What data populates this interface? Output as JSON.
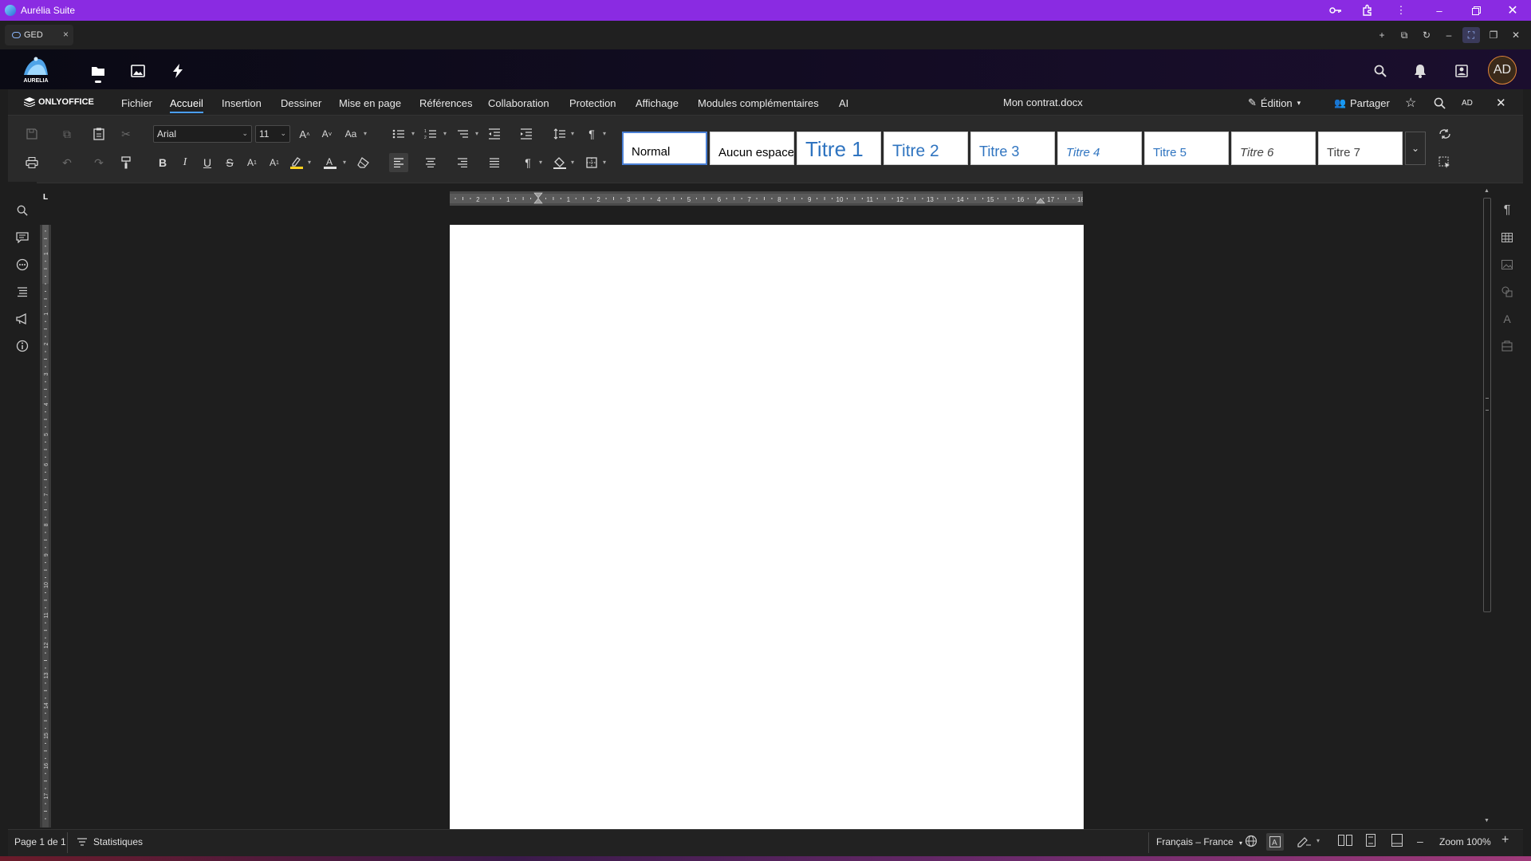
{
  "window": {
    "title": "Aurélia Suite"
  },
  "browser": {
    "tab_label": "GED"
  },
  "app_nav": {
    "logo_text": "AURELIA",
    "avatar_initials": "AD"
  },
  "onlyoffice": {
    "brand": "ONLYOFFICE",
    "menu": [
      "Fichier",
      "Accueil",
      "Insertion",
      "Dessiner",
      "Mise en page",
      "Références",
      "Collaboration",
      "Protection",
      "Affichage",
      "Modules complémentaires",
      "AI"
    ],
    "active_menu": "Accueil",
    "document_title": "Mon contrat.docx",
    "mode_label": "Édition",
    "share_label": "Partager",
    "user_initials": "AD"
  },
  "toolbar": {
    "font_name": "Arial",
    "font_size": "11",
    "styles": [
      "Normal",
      "Aucun espace",
      "Titre 1",
      "Titre 2",
      "Titre 3",
      "Titre 4",
      "Titre 5",
      "Titre 6",
      "Titre 7"
    ],
    "selected_style": "Normal",
    "highlight_color": "#ffd21f",
    "font_color": "#e0e0e0"
  },
  "ruler": {
    "corner_label": "L"
  },
  "status": {
    "page_info": "Page 1 de 1",
    "statistics_label": "Statistiques",
    "language": "Français – France",
    "zoom_label": "Zoom 100%"
  },
  "colors": {
    "titlebar": "#8a2be2",
    "accent": "#4a9eff",
    "heading_blue": "#2f74c0"
  }
}
